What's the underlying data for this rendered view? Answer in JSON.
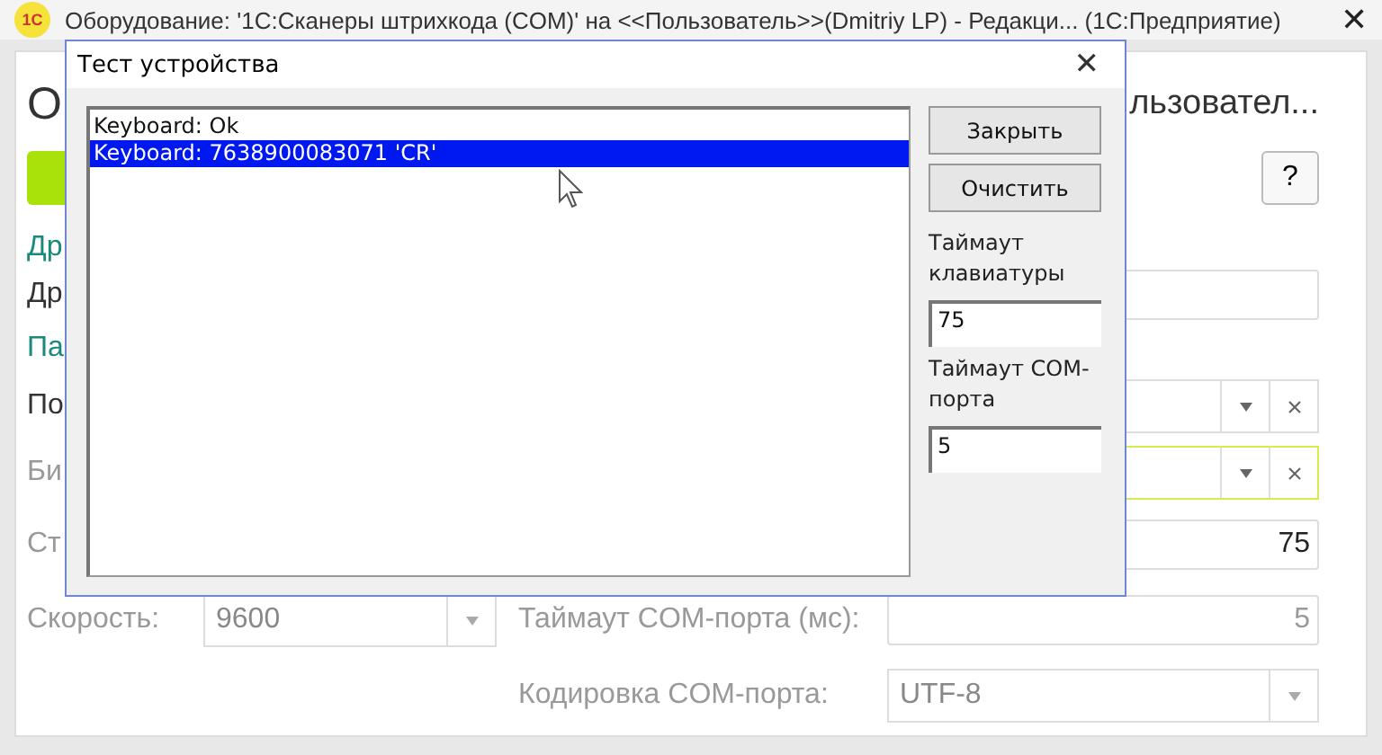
{
  "window": {
    "logo": "1С",
    "title": "Оборудование: '1С:Сканеры штрихкода (COM)' на <<Пользователь>>(Dmitriy LP) - Редакци... (1С:Предприятие)",
    "close": "✕"
  },
  "form": {
    "heading_left": "О",
    "heading_right": "льзовател...",
    "help": "?",
    "rows": [
      {
        "kind": "section",
        "label": "Др"
      },
      {
        "kind": "field",
        "label": "Др",
        "disabled": false
      },
      {
        "kind": "section",
        "label": "Па"
      },
      {
        "kind": "combo",
        "label": "По",
        "disabled": false,
        "focused": false
      },
      {
        "kind": "combo",
        "label": "Би",
        "disabled": true,
        "focused": true
      },
      {
        "kind": "field",
        "label": "Ст",
        "value": "75",
        "disabled": true
      },
      {
        "kind": "pair",
        "label": "Скорость:",
        "value": "9600",
        "label2": "Таймаут COM-порта (мс):",
        "value2": "5",
        "disabled": true
      },
      {
        "kind": "select",
        "label2": "Кодировка COM-порта:",
        "value2": "UTF-8",
        "disabled": true
      }
    ]
  },
  "dialog": {
    "title": "Тест устройства",
    "close": "✕",
    "log": [
      {
        "text": "Keyboard: Ok",
        "selected": false
      },
      {
        "text": "Keyboard: 7638900083071 'CR'",
        "selected": true
      }
    ],
    "buttons": [
      "Закрыть",
      "Очистить"
    ],
    "keyboard_timeout": {
      "label": "Таймаут клавиатуры",
      "value": "75"
    },
    "com_timeout": {
      "label": "Таймаут COM-порта",
      "value": "5"
    }
  }
}
